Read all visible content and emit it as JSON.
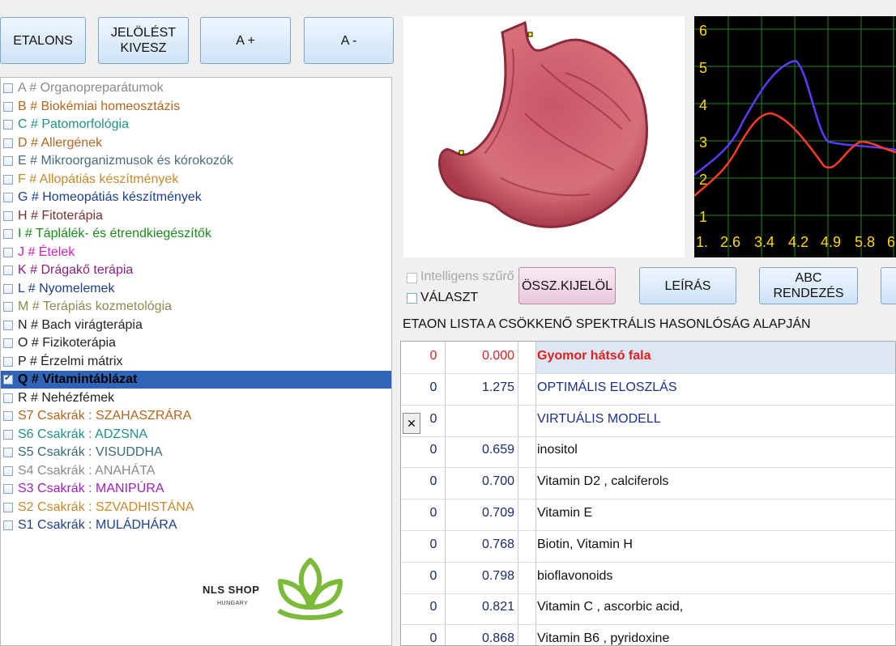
{
  "toolbar": {
    "etalons": "ETALONS",
    "jeloles_kivesz": "JELÖLÉST KIVESZ",
    "a_plus": "A +",
    "a_minus": "A -"
  },
  "categories": [
    {
      "label": "A # Organopreparátumok",
      "color": "#8a8a8a"
    },
    {
      "label": "B # Biokémiai homeosztázis",
      "color": "#b5651d"
    },
    {
      "label": "C # Patomorfológia",
      "color": "#20908c"
    },
    {
      "label": "D # Allergének",
      "color": "#b5651d"
    },
    {
      "label": "E # Mikroorganizmusok és kórokozók",
      "color": "#4a6a7a"
    },
    {
      "label": "F # Allopátiás készítmények",
      "color": "#c8882a"
    },
    {
      "label": "G # Homeopátiás készítmények",
      "color": "#1c3f8a"
    },
    {
      "label": "H # Fitoterápia",
      "color": "#7a3030"
    },
    {
      "label": "I # Táplálék- és étrendkiegészítők",
      "color": "#1a8a1a"
    },
    {
      "label": "J # Ételek",
      "color": "#d020c0"
    },
    {
      "label": "K # Drágakő terápia",
      "color": "#8a2080"
    },
    {
      "label": "L # Nyomelemek",
      "color": "#1c3f8a"
    },
    {
      "label": "M # Terápiás kozmetológia",
      "color": "#8a8a50"
    },
    {
      "label": "N # Bach virágterápia",
      "color": "#222222"
    },
    {
      "label": "O # Fizikoterápia",
      "color": "#222222"
    },
    {
      "label": "P # Érzelmi mátrix",
      "color": "#222222"
    },
    {
      "label": "Q # Vitamintáblázat",
      "color": "#000000",
      "selected": true
    },
    {
      "label": "R # Nehézfémek",
      "color": "#222222"
    },
    {
      "label": "S7 Csakrák : SZAHASZRÁRA",
      "color": "#b5651d"
    },
    {
      "label": "S6 Csakrák : ADZSNA",
      "color": "#20908c"
    },
    {
      "label": "S5 Csakrák : VISUDDHA",
      "color": "#3a6a7a"
    },
    {
      "label": "S4 Csakrák : ANAHÁTA",
      "color": "#8a8a8a"
    },
    {
      "label": "S3 Csakrák : MANIPÚRA",
      "color": "#a020c0"
    },
    {
      "label": "S2 Csakrák : SZVADHISTÁNA",
      "color": "#c8882a"
    },
    {
      "label": "S1 Csakrák : MULÁDHÁRA",
      "color": "#1c3f8a"
    }
  ],
  "logo": {
    "brand": "NLS SHOP",
    "sub": "HUNGARY",
    "color": "#7cba3a"
  },
  "graph": {
    "y_ticks": [
      "6",
      "5",
      "4",
      "3",
      "2",
      "1"
    ],
    "x_ticks": [
      "1.",
      "2.6",
      "3.4",
      "4.2",
      "4.9",
      "5.8",
      "6"
    ]
  },
  "controls": {
    "intelligens": "Intelligens szűrő",
    "valaszt": "VÁLASZT",
    "ossz_kijelol": "ÖSSZ.KIJELÖL",
    "leiras": "LEÍRÁS",
    "abc_rendezes": "ABC RENDEZÉS"
  },
  "list_heading": "ETAON LISTA A CSÖKKENŐ SPEKTRÁLIS HASONLÓSÁG ALAPJÁN",
  "table_rows": [
    {
      "a": "0",
      "b": "0.000",
      "name": "Gyomor hátsó fala",
      "style": "red"
    },
    {
      "a": "0",
      "b": "1.275",
      "name": "OPTIMÁLIS ELOSZLÁS",
      "style": "blue"
    },
    {
      "a": "0",
      "b": "",
      "name": "VIRTUÁLIS MODELL",
      "style": "blue",
      "x": "✕"
    },
    {
      "a": "0",
      "b": "0.659",
      "name": "inositol"
    },
    {
      "a": "0",
      "b": "0.700",
      "name": "Vitamin D2 , calciferols"
    },
    {
      "a": "0",
      "b": "0.709",
      "name": "Vitamin E"
    },
    {
      "a": "0",
      "b": "0.768",
      "name": "Biotin, Vitamin H"
    },
    {
      "a": "0",
      "b": "0.798",
      "name": "bioflavonoids"
    },
    {
      "a": "0",
      "b": "0.821",
      "name": "Vitamin C , ascorbic acid,"
    },
    {
      "a": "0",
      "b": "0.868",
      "name": "Vitamin B6 , pyridoxine"
    }
  ]
}
